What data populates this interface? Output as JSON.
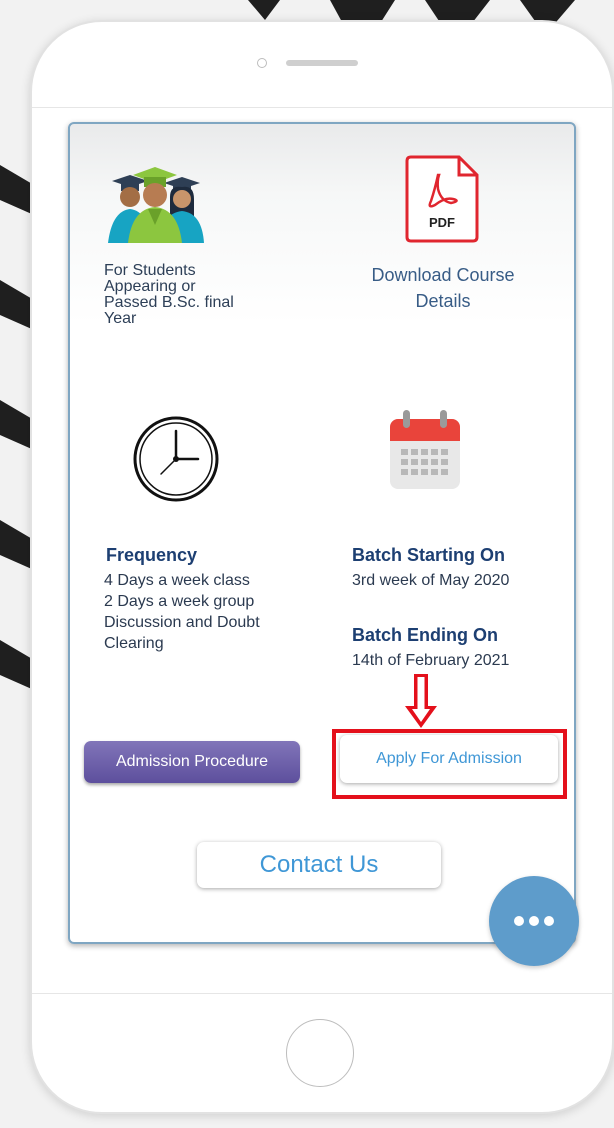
{
  "course_card": {
    "eligibility_text": [
      "For Students",
      "Appearing or",
      "Passed B.Sc. final",
      "Year"
    ],
    "download_text": [
      "Download Course",
      "Details"
    ],
    "pdf_icon_label": "PDF",
    "frequency": {
      "title": "Frequency",
      "lines": [
        "4 Days a week class",
        "2 Days a week group",
        "Discussion and Doubt",
        "Clearing"
      ]
    },
    "batch_start": {
      "title": "Batch Starting On",
      "value": "3rd week of May 2020"
    },
    "batch_end": {
      "title": "Batch Ending On",
      "value": "14th of February 2021"
    }
  },
  "buttons": {
    "admission_procedure": "Admission Procedure",
    "apply_for_admission": "Apply For Admission",
    "contact_us": "Contact Us"
  },
  "icons": {
    "graduates": "graduates-icon",
    "pdf": "pdf-icon",
    "clock": "clock-icon",
    "calendar": "calendar-icon",
    "arrow": "down-arrow-icon",
    "more": "more-icon"
  },
  "colors": {
    "accent_blue": "#3f97d6",
    "title_navy": "#1d3f72",
    "admission_purple": "#6d5fab",
    "highlight_red": "#e4101b",
    "fab_blue": "#5e9ccb"
  }
}
